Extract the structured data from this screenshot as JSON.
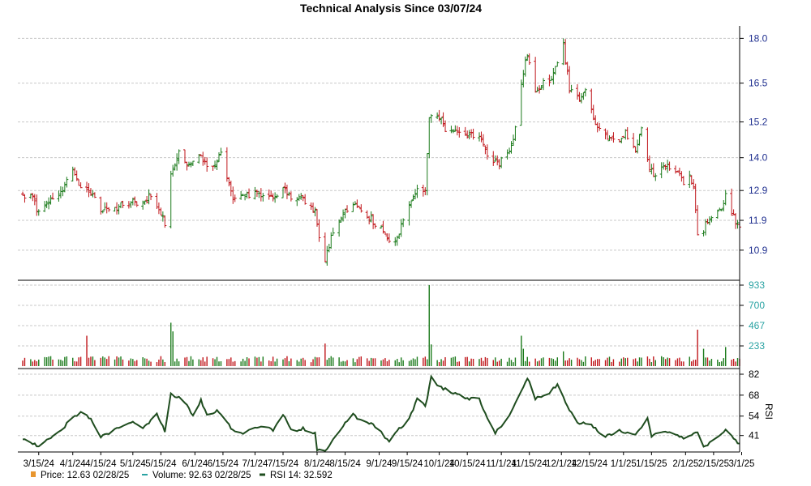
{
  "chart_data": {
    "type": "ohlc",
    "title": "Technical Analysis Since 03/07/24",
    "colors": {
      "up": "#1a7a1a",
      "down": "#c0161b",
      "rsi": "#1f4d1f",
      "price_axis": "#1f2f8f",
      "volume_axis": "#2aa3a3",
      "rsi_axis": "#000000",
      "legend_price": "#e8962f",
      "legend_volume": "#2aa3a3",
      "legend_rsi": "#1f4d1f"
    },
    "x_ticks": [
      "3/15/24",
      "4/1/24",
      "4/15/24",
      "5/1/24",
      "5/15/24",
      "6/1/24",
      "6/15/24",
      "7/1/24",
      "7/15/24",
      "8/1/24",
      "8/15/24",
      "9/1/24",
      "9/15/24",
      "10/1/24",
      "10/15/24",
      "11/1/24",
      "11/15/24",
      "12/1/24",
      "12/15/24",
      "1/1/25",
      "1/15/25",
      "2/1/25",
      "2/15/25",
      "3/1/25"
    ],
    "price": {
      "ylim": [
        10.0,
        18.2
      ],
      "ticks": [
        "18.0",
        "16.5",
        "15.2",
        "14.0",
        "12.9",
        "11.9",
        "10.9"
      ],
      "tick_values": [
        18.0,
        16.5,
        15.2,
        14.0,
        12.9,
        11.9,
        10.9
      ],
      "key_points": [
        [
          "3/7/24",
          12.8
        ],
        [
          "3/12/24",
          12.6
        ],
        [
          "3/15/24",
          12.1
        ],
        [
          "3/20/24",
          12.6
        ],
        [
          "3/27/24",
          12.9
        ],
        [
          "4/1/24",
          13.6
        ],
        [
          "4/5/24",
          13.0
        ],
        [
          "4/10/24",
          12.9
        ],
        [
          "4/15/24",
          12.2
        ],
        [
          "4/22/24",
          12.3
        ],
        [
          "4/30/24",
          12.5
        ],
        [
          "5/6/24",
          12.4
        ],
        [
          "5/10/24",
          12.8
        ],
        [
          "5/15/24",
          12.2
        ],
        [
          "5/17/24",
          11.8
        ],
        [
          "5/20/24",
          13.5
        ],
        [
          "5/24/24",
          14.2
        ],
        [
          "5/28/24",
          13.8
        ],
        [
          "6/3/24",
          14.1
        ],
        [
          "6/7/24",
          13.7
        ],
        [
          "6/12/24",
          13.9
        ],
        [
          "6/14/24",
          14.1
        ],
        [
          "6/17/24",
          13.4
        ],
        [
          "6/20/24",
          12.6
        ],
        [
          "6/26/24",
          12.7
        ],
        [
          "7/3/24",
          12.8
        ],
        [
          "7/10/24",
          12.6
        ],
        [
          "7/15/24",
          12.9
        ],
        [
          "7/20/24",
          12.6
        ],
        [
          "7/25/24",
          12.6
        ],
        [
          "7/31/24",
          12.2
        ],
        [
          "8/2/24",
          11.4
        ],
        [
          "8/5/24",
          10.6
        ],
        [
          "8/8/24",
          11.3
        ],
        [
          "8/12/24",
          11.8
        ],
        [
          "8/16/24",
          12.3
        ],
        [
          "8/20/24",
          12.4
        ],
        [
          "8/26/24",
          12.1
        ],
        [
          "8/30/24",
          11.8
        ],
        [
          "9/3/24",
          11.6
        ],
        [
          "9/6/24",
          11.1
        ],
        [
          "9/9/24",
          11.3
        ],
        [
          "9/13/24",
          11.8
        ],
        [
          "9/17/24",
          12.5
        ],
        [
          "9/20/24",
          12.9
        ],
        [
          "9/24/24",
          13.0
        ],
        [
          "9/26/24",
          15.3
        ],
        [
          "9/30/24",
          15.5
        ],
        [
          "10/4/24",
          15.0
        ],
        [
          "10/10/24",
          14.9
        ],
        [
          "10/15/24",
          14.8
        ],
        [
          "10/21/24",
          14.7
        ],
        [
          "10/25/24",
          14.0
        ],
        [
          "10/31/24",
          13.8
        ],
        [
          "11/4/24",
          14.1
        ],
        [
          "11/7/24",
          14.5
        ],
        [
          "11/11/24",
          16.5
        ],
        [
          "11/14/24",
          17.5
        ],
        [
          "11/18/24",
          16.3
        ],
        [
          "11/22/24",
          16.5
        ],
        [
          "11/26/24",
          16.6
        ],
        [
          "12/2/24",
          17.8
        ],
        [
          "12/5/24",
          16.3
        ],
        [
          "12/10/24",
          16.0
        ],
        [
          "12/13/24",
          16.2
        ],
        [
          "12/18/24",
          15.2
        ],
        [
          "12/23/24",
          14.8
        ],
        [
          "12/27/24",
          14.5
        ],
        [
          "1/2/25",
          14.8
        ],
        [
          "1/7/25",
          14.3
        ],
        [
          "1/10/25",
          14.9
        ],
        [
          "1/14/25",
          13.6
        ],
        [
          "1/17/25",
          13.4
        ],
        [
          "1/22/25",
          13.8
        ],
        [
          "1/27/25",
          13.5
        ],
        [
          "1/31/25",
          13.2
        ],
        [
          "2/3/25",
          13.4
        ],
        [
          "2/5/25",
          13.0
        ],
        [
          "2/7/25",
          11.5
        ],
        [
          "2/10/25",
          11.6
        ],
        [
          "2/13/25",
          12.0
        ],
        [
          "2/18/25",
          12.2
        ],
        [
          "2/21/25",
          12.7
        ],
        [
          "2/25/25",
          12.0
        ],
        [
          "2/28/25",
          11.6
        ]
      ]
    },
    "volume": {
      "ylim": [
        0,
        933
      ],
      "ticks": [
        "933",
        "700",
        "467",
        "233"
      ],
      "tick_values": [
        933,
        700,
        467,
        233
      ],
      "spikes": [
        [
          "4/8/24",
          350
        ],
        [
          "5/20/24",
          500
        ],
        [
          "5/21/24",
          400
        ],
        [
          "8/5/24",
          260
        ],
        [
          "9/26/24",
          933
        ],
        [
          "9/27/24",
          250
        ],
        [
          "11/11/24",
          350
        ],
        [
          "11/12/24",
          200
        ],
        [
          "12/2/24",
          170
        ],
        [
          "2/7/25",
          420
        ],
        [
          "2/10/25",
          200
        ],
        [
          "2/21/25",
          220
        ]
      ]
    },
    "rsi": {
      "ylim": [
        30,
        82
      ],
      "ticks": [
        "82",
        "68",
        "54",
        "41"
      ],
      "tick_values": [
        82,
        68,
        54,
        41
      ],
      "label": "RSI",
      "key_points": [
        [
          "3/7/24",
          39
        ],
        [
          "3/15/24",
          34
        ],
        [
          "3/27/24",
          46
        ],
        [
          "4/1/24",
          53
        ],
        [
          "4/5/24",
          57
        ],
        [
          "4/10/24",
          52
        ],
        [
          "4/15/24",
          40
        ],
        [
          "4/24/24",
          46
        ],
        [
          "5/1/24",
          50
        ],
        [
          "5/6/24",
          46
        ],
        [
          "5/13/24",
          55
        ],
        [
          "5/17/24",
          44
        ],
        [
          "5/20/24",
          69
        ],
        [
          "5/24/24",
          66
        ],
        [
          "5/28/24",
          62
        ],
        [
          "5/31/24",
          54
        ],
        [
          "6/4/24",
          65
        ],
        [
          "6/7/24",
          55
        ],
        [
          "6/12/24",
          58
        ],
        [
          "6/15/24",
          55
        ],
        [
          "6/20/24",
          44
        ],
        [
          "6/26/24",
          43
        ],
        [
          "7/1/24",
          47
        ],
        [
          "7/10/24",
          45
        ],
        [
          "7/15/24",
          55
        ],
        [
          "7/20/24",
          43
        ],
        [
          "7/25/24",
          46
        ],
        [
          "7/31/24",
          42
        ],
        [
          "8/1/24",
          32
        ],
        [
          "8/5/24",
          31
        ],
        [
          "8/9/24",
          38
        ],
        [
          "8/14/24",
          47
        ],
        [
          "8/19/24",
          56
        ],
        [
          "8/22/24",
          51
        ],
        [
          "8/29/24",
          49
        ],
        [
          "9/3/24",
          41
        ],
        [
          "9/6/24",
          37
        ],
        [
          "9/10/24",
          44
        ],
        [
          "9/16/24",
          52
        ],
        [
          "9/20/24",
          66
        ],
        [
          "9/24/24",
          60
        ],
        [
          "9/27/24",
          80
        ],
        [
          "10/1/24",
          74
        ],
        [
          "10/8/24",
          69
        ],
        [
          "10/15/24",
          66
        ],
        [
          "10/21/24",
          65
        ],
        [
          "10/25/24",
          52
        ],
        [
          "10/29/24",
          43
        ],
        [
          "11/5/24",
          54
        ],
        [
          "11/8/24",
          62
        ],
        [
          "11/14/24",
          80
        ],
        [
          "11/18/24",
          66
        ],
        [
          "11/25/24",
          70
        ],
        [
          "11/29/24",
          75
        ],
        [
          "12/4/24",
          60
        ],
        [
          "12/9/24",
          50
        ],
        [
          "12/16/24",
          48
        ],
        [
          "12/22/24",
          40
        ],
        [
          "12/30/24",
          44
        ],
        [
          "1/6/25",
          41
        ],
        [
          "1/13/25",
          52
        ],
        [
          "1/15/25",
          41
        ],
        [
          "1/22/25",
          43
        ],
        [
          "2/1/25",
          39
        ],
        [
          "2/7/25",
          43
        ],
        [
          "2/10/25",
          33
        ],
        [
          "2/14/25",
          37
        ],
        [
          "2/21/25",
          44
        ],
        [
          "2/27/25",
          36
        ],
        [
          "2/28/25",
          35
        ]
      ]
    },
    "legend": {
      "price": "Price: 12.63  02/28/25",
      "volume": "Volume: 92.63  02/28/25",
      "rsi": "RSI 14: 32.592"
    }
  }
}
